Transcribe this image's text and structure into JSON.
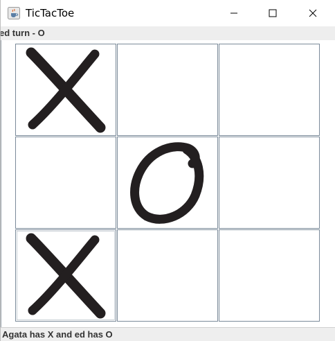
{
  "window": {
    "title": "TicTacToe",
    "app_icon": "java-cup-icon",
    "controls": [
      "minimize-icon",
      "maximize-icon",
      "close-icon"
    ]
  },
  "status": {
    "turn": "ed turn - O",
    "players": "Agata has X and ed has O"
  },
  "board": {
    "cells": [
      "X",
      "",
      "",
      "",
      "O",
      "",
      "X",
      "",
      ""
    ]
  },
  "colors": {
    "mark": "#231f20",
    "grid_line": "#7a8a99",
    "status_bg": "#eeeeee"
  }
}
